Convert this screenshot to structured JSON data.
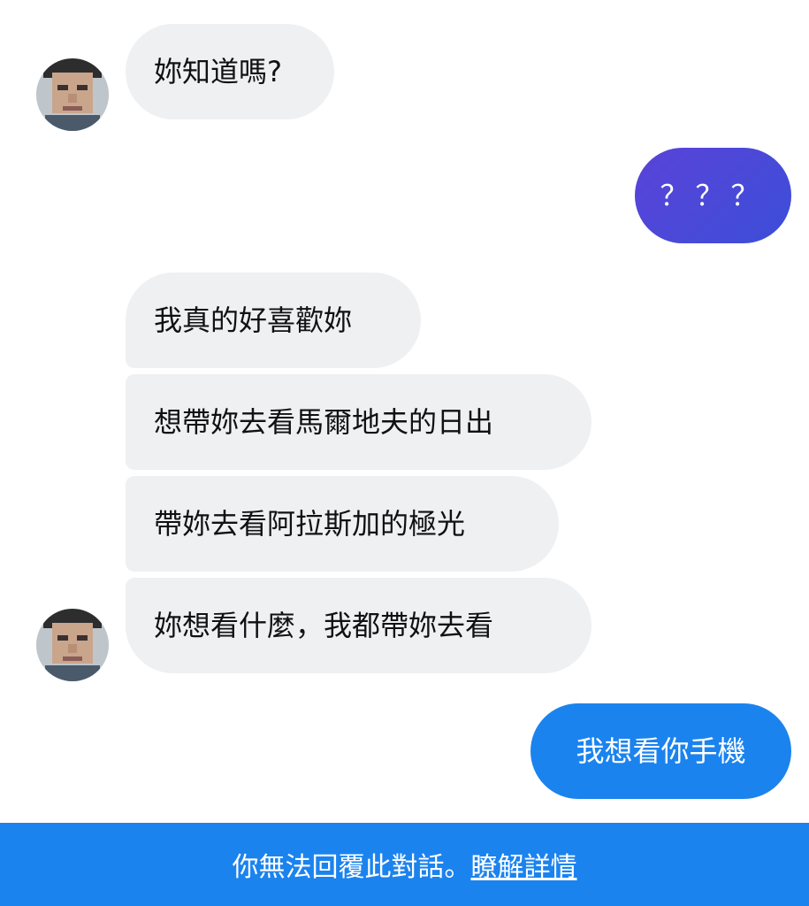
{
  "messages": [
    {
      "text": "妳知道嗎?"
    },
    {
      "text": "？？？"
    },
    {
      "text": "我真的好喜歡妳"
    },
    {
      "text": "想帶妳去看馬爾地夫的日出"
    },
    {
      "text": "帶妳去看阿拉斯加的極光"
    },
    {
      "text": "妳想看什麼，我都帶妳去看"
    },
    {
      "text": "我想看你手機"
    }
  ],
  "footer": {
    "notice": "你無法回覆此對話。",
    "link": "瞭解詳情"
  },
  "colors": {
    "received_bubble": "#eef0f2",
    "sent_bubble_gradient_start": "#5a43d9",
    "sent_bubble_gradient_end": "#3c4ed8",
    "sent_bubble_blue": "#1b83ee",
    "footer_background": "#1b83ee"
  },
  "icons": {
    "contact_avatar": "pixelated-profile-photo"
  }
}
